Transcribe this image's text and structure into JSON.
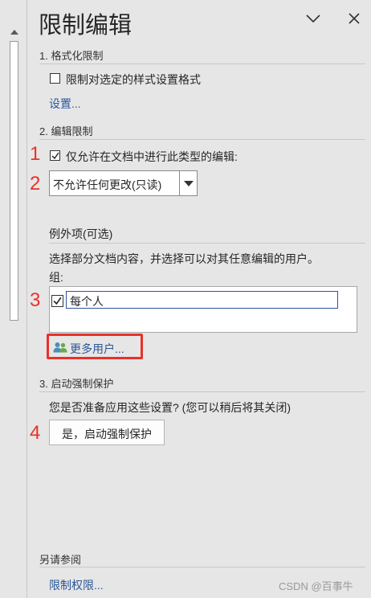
{
  "pane": {
    "title": "限制编辑",
    "chevron_icon": "chevron-down-icon",
    "close_icon": "close-icon"
  },
  "section_formatting": {
    "heading": "1. 格式化限制",
    "checkbox_label": "限制对选定的样式设置格式",
    "checkbox_checked": false,
    "settings_link": "设置..."
  },
  "section_editing": {
    "heading": "2. 编辑限制",
    "checkbox_label": "仅允许在文档中进行此类型的编辑:",
    "checkbox_checked": true,
    "dropdown_value": "不允许任何更改(只读)",
    "exceptions_heading": "例外项(可选)",
    "exceptions_desc": "选择部分文档内容，并选择可以对其任意编辑的用户。",
    "groups_label": "组:",
    "groups": [
      {
        "name": "每个人",
        "checked": true
      }
    ],
    "more_users_label": "更多用户...",
    "more_users_icon": "people-icon"
  },
  "section_enforce": {
    "heading": "3. 启动强制保护",
    "question": "您是否准备应用这些设置? (您可以稍后将其关闭)",
    "button_label": "是，启动强制保护"
  },
  "see_also": {
    "heading": "另请参阅",
    "link": "限制权限..."
  },
  "annotations": {
    "step1": "1",
    "step2": "2",
    "step3": "3",
    "step4": "4",
    "color": "#e8312a"
  },
  "watermark": "CSDN @百事牛",
  "colors": {
    "link": "#2b579a",
    "background": "#e6e6e6",
    "highlight_box": "#e8312a"
  }
}
